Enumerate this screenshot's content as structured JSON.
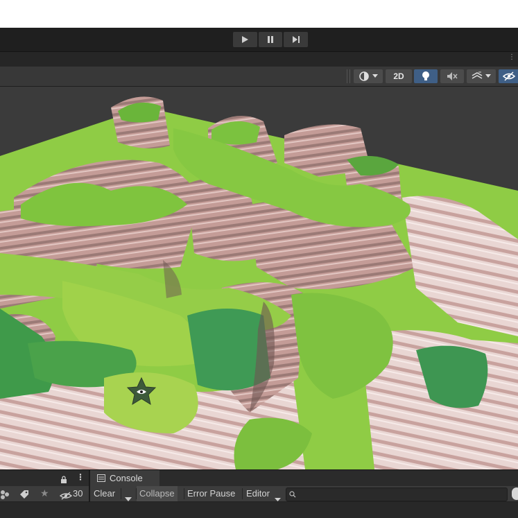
{
  "toolbar": {
    "mode_2d_label": "2D"
  },
  "console": {
    "tab_label": "Console",
    "hidden_count": "30",
    "clear_label": "Clear",
    "collapse_label": "Collapse",
    "error_pause_label": "Error Pause",
    "editor_label": "Editor",
    "search_placeholder": ""
  },
  "colors": {
    "grass": "#7cc23a",
    "grass_dark": "#4f9a3c",
    "rock": "#b88f8c",
    "rock_dark": "#7f6661",
    "active_button": "#3f5f86"
  }
}
